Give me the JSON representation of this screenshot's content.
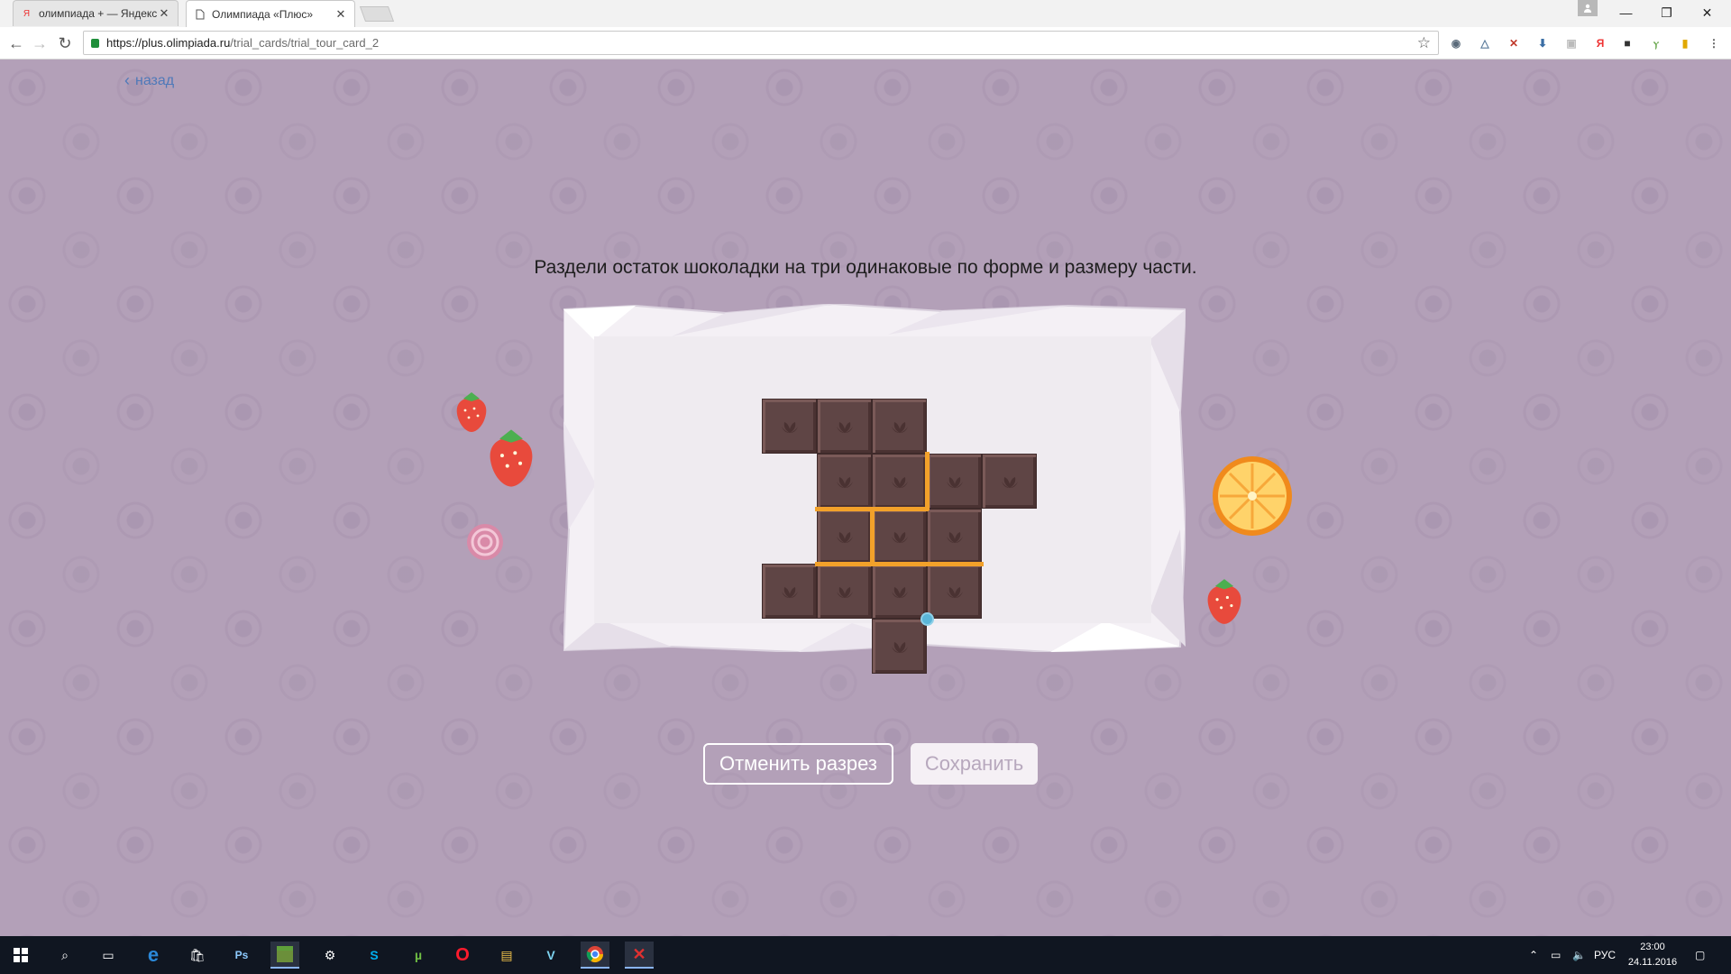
{
  "browser": {
    "tabs": [
      {
        "title": "олимпиада + — Яндекс",
        "favicon": "yandex-icon"
      },
      {
        "title": "Олимпиада «Плюс»",
        "favicon": "page-icon"
      }
    ],
    "address": {
      "host": "https://plus.olimpiada.ru",
      "path": "/trial_cards/trial_tour_card_2"
    }
  },
  "page": {
    "back_label": "назад",
    "task_text": "Раздели остаток шоколадки на три одинаковые по форме и размеру части.",
    "cancel_button": "Отменить разрез",
    "save_button": "Сохранить"
  },
  "puzzle": {
    "pieces": [
      [
        0,
        0
      ],
      [
        1,
        0
      ],
      [
        2,
        0
      ],
      [
        1,
        1
      ],
      [
        2,
        1
      ],
      [
        3,
        1
      ],
      [
        4,
        1
      ],
      [
        1,
        2
      ],
      [
        2,
        2
      ],
      [
        3,
        2
      ],
      [
        0,
        3
      ],
      [
        1,
        3
      ],
      [
        2,
        3
      ],
      [
        3,
        3
      ],
      [
        2,
        4
      ]
    ],
    "cuts_made": 4,
    "colors": {
      "chocolate": "#5f4545",
      "cut_line": "#f2a12a",
      "cursor_dot": "#5ab6d8"
    }
  },
  "taskbar": {
    "language": "РУС",
    "time": "23:00",
    "date": "24.11.2016",
    "apps": [
      "start-icon",
      "search-icon",
      "task-view-icon",
      "edge-icon",
      "store-icon",
      "photoshop-icon",
      "minecraft-icon",
      "settings-icon",
      "skype-icon",
      "utorrent-icon",
      "opera-icon",
      "file-explorer-icon",
      "vpn-icon",
      "chrome-icon",
      "app-icon"
    ]
  }
}
